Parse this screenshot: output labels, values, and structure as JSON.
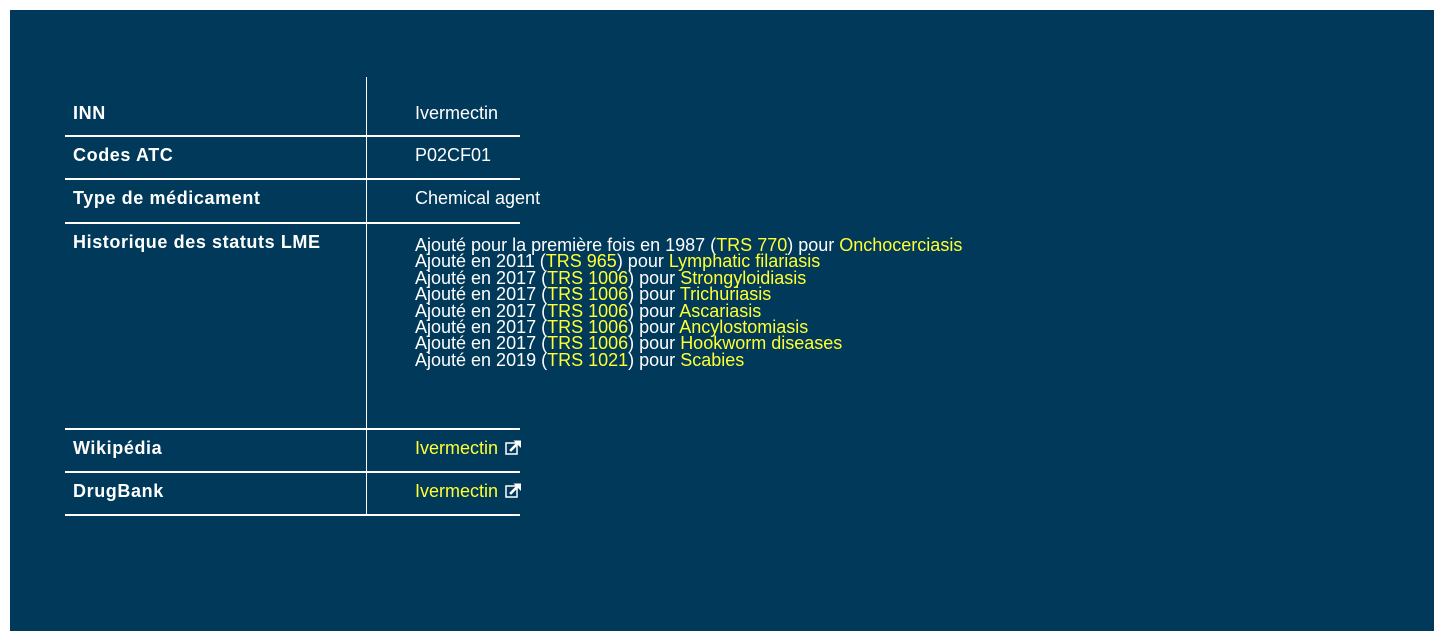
{
  "table": {
    "inn": {
      "label": "INN",
      "value": "Ivermectin"
    },
    "atc": {
      "label": "Codes ATC",
      "value": "P02CF01"
    },
    "type": {
      "label": "Type de médicament",
      "value": "Chemical agent"
    },
    "history": {
      "label": "Historique des statuts LME",
      "entries": [
        {
          "prefix": "Ajouté pour la première fois en 1987 (",
          "trs": "TRS 770",
          "mid": ") pour ",
          "indication": "Onchocerciasis"
        },
        {
          "prefix": "Ajouté en 2011 (",
          "trs": "TRS 965",
          "mid": ") pour ",
          "indication": "Lymphatic filariasis"
        },
        {
          "prefix": "Ajouté en 2017 (",
          "trs": "TRS 1006",
          "mid": ") pour ",
          "indication": "Strongyloidiasis"
        },
        {
          "prefix": "Ajouté en 2017 (",
          "trs": "TRS 1006",
          "mid": ") pour ",
          "indication": "Trichuriasis"
        },
        {
          "prefix": "Ajouté en 2017 (",
          "trs": "TRS 1006",
          "mid": ") pour ",
          "indication": "Ascariasis"
        },
        {
          "prefix": "Ajouté en 2017 (",
          "trs": "TRS 1006",
          "mid": ") pour ",
          "indication": "Ancylostomiasis"
        },
        {
          "prefix": "Ajouté en 2017 (",
          "trs": "TRS 1006",
          "mid": ") pour ",
          "indication": "Hookworm diseases"
        },
        {
          "prefix": "Ajouté en 2019 (",
          "trs": "TRS 1021",
          "mid": ") pour ",
          "indication": "Scabies"
        }
      ]
    },
    "wikipedia": {
      "label": "Wikipédia",
      "link": "Ivermectin",
      "icon": "external-link-icon"
    },
    "drugbank": {
      "label": "DrugBank",
      "link": "Ivermectin",
      "icon": "external-link-icon"
    }
  },
  "colors": {
    "background": "#00395a",
    "text": "#ffffff",
    "link": "#ffff33"
  }
}
